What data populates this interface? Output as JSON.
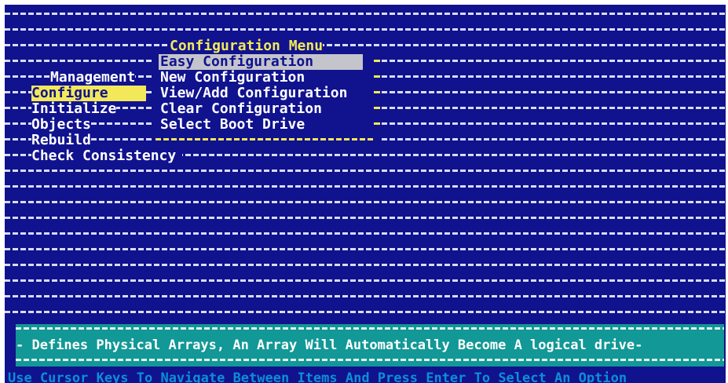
{
  "config_menu": {
    "title": "Configuration Menu",
    "items": [
      {
        "label": "Easy Configuration",
        "selected": true
      },
      {
        "label": "New Configuration",
        "selected": false
      },
      {
        "label": "View/Add Configuration",
        "selected": false
      },
      {
        "label": "Clear Configuration",
        "selected": false
      },
      {
        "label": "Select Boot Drive",
        "selected": false
      }
    ]
  },
  "management_menu": {
    "title": "Management",
    "items": [
      {
        "label": "Configure",
        "selected": true
      },
      {
        "label": "Initialize",
        "selected": false
      },
      {
        "label": "Objects",
        "selected": false
      },
      {
        "label": "Rebuild",
        "selected": false
      },
      {
        "label": "Check Consistency",
        "selected": false
      }
    ]
  },
  "status_line": "Defines Physical Arrays, An Array Will Automatically Become A logical drive",
  "help_line": "Use Cursor Keys To Navigate Between Items And Press Enter To Select An Option",
  "colors": {
    "background": "#10128e",
    "menu_title": "#f2e85a",
    "highlight": "#c4c4cc",
    "status_bar": "#129896",
    "help_text": "#0d8fd6"
  }
}
